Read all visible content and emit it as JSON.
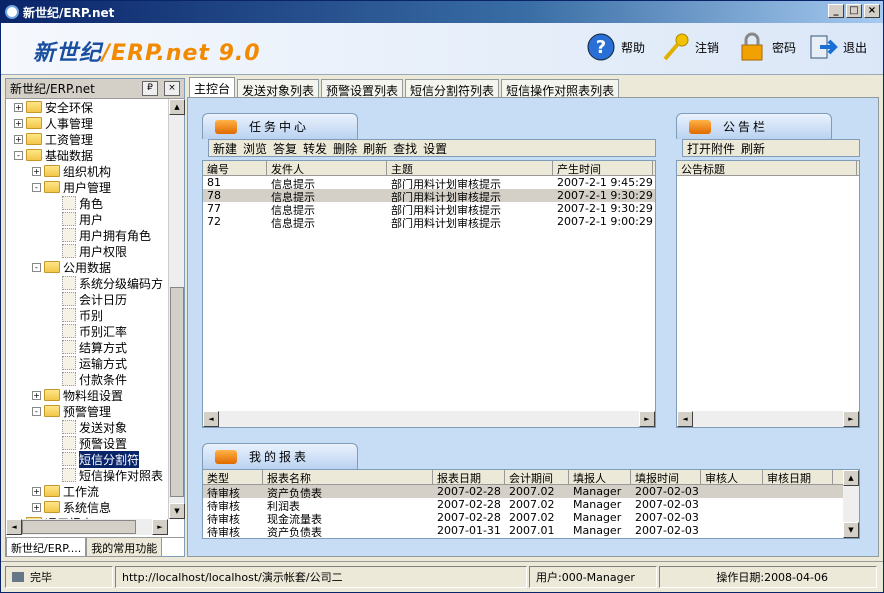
{
  "window": {
    "title": "新世纪/ERP.net",
    "controls": [
      "_",
      "□",
      "×"
    ]
  },
  "header": {
    "logo_main": "新世纪",
    "logo_suffix": "/ERP.net 9.0",
    "help": "帮助",
    "logout": "注销",
    "password": "密码",
    "exit": "退出"
  },
  "left": {
    "title": "新世纪/ERP.net",
    "pin": "₽",
    "close": "×",
    "tabs": [
      "新世纪/ERP....",
      "我的常用功能"
    ],
    "tree": [
      {
        "label": "安全环保",
        "level": 0,
        "type": "folder",
        "exp": "+"
      },
      {
        "label": "人事管理",
        "level": 0,
        "type": "folder",
        "exp": "+"
      },
      {
        "label": "工资管理",
        "level": 0,
        "type": "folder",
        "exp": "+"
      },
      {
        "label": "基础数据",
        "level": 0,
        "type": "folder",
        "exp": "-"
      },
      {
        "label": "组织机构",
        "level": 1,
        "type": "folder",
        "exp": "+"
      },
      {
        "label": "用户管理",
        "level": 1,
        "type": "folder",
        "exp": "-"
      },
      {
        "label": "角色",
        "level": 2,
        "type": "leaf"
      },
      {
        "label": "用户",
        "level": 2,
        "type": "leaf"
      },
      {
        "label": "用户拥有角色",
        "level": 2,
        "type": "leaf"
      },
      {
        "label": "用户权限",
        "level": 2,
        "type": "leaf"
      },
      {
        "label": "公用数据",
        "level": 1,
        "type": "folder",
        "exp": "-"
      },
      {
        "label": "系统分级编码方",
        "level": 2,
        "type": "leaf"
      },
      {
        "label": "会计日历",
        "level": 2,
        "type": "leaf"
      },
      {
        "label": "币别",
        "level": 2,
        "type": "leaf"
      },
      {
        "label": "币别汇率",
        "level": 2,
        "type": "leaf"
      },
      {
        "label": "结算方式",
        "level": 2,
        "type": "leaf"
      },
      {
        "label": "运输方式",
        "level": 2,
        "type": "leaf"
      },
      {
        "label": "付款条件",
        "level": 2,
        "type": "leaf"
      },
      {
        "label": "物料组设置",
        "level": 1,
        "type": "folder",
        "exp": "+"
      },
      {
        "label": "预警管理",
        "level": 1,
        "type": "folder",
        "exp": "-"
      },
      {
        "label": "发送对象",
        "level": 2,
        "type": "leaf"
      },
      {
        "label": "预警设置",
        "level": 2,
        "type": "leaf"
      },
      {
        "label": "短信分割符",
        "level": 2,
        "type": "leaf",
        "selected": true
      },
      {
        "label": "短信操作对照表",
        "level": 2,
        "type": "leaf"
      },
      {
        "label": "工作流",
        "level": 1,
        "type": "folder",
        "exp": "+"
      },
      {
        "label": "系统信息",
        "level": 1,
        "type": "folder",
        "exp": "+"
      },
      {
        "label": "通用报表",
        "level": 0,
        "type": "folder",
        "exp": "+"
      }
    ]
  },
  "tabs": [
    {
      "label": "主控台",
      "active": true
    },
    {
      "label": "发送对象列表"
    },
    {
      "label": "预警设置列表"
    },
    {
      "label": "短信分割符列表"
    },
    {
      "label": "短信操作对照表列表"
    }
  ],
  "task": {
    "title": "任务中心",
    "toolbar": [
      "新建",
      "浏览",
      "答复",
      "转发",
      "删除",
      "刷新",
      "查找",
      "设置"
    ],
    "columns": [
      "编号",
      "发件人",
      "主题",
      "产生时间"
    ],
    "rows": [
      [
        "81",
        "信息提示",
        "部门用料计划审核提示",
        "2007-2-1 9:45:29"
      ],
      [
        "78",
        "信息提示",
        "部门用料计划审核提示",
        "2007-2-1 9:30:29"
      ],
      [
        "77",
        "信息提示",
        "部门用料计划审核提示",
        "2007-2-1 9:30:29"
      ],
      [
        "72",
        "信息提示",
        "部门用料计划审核提示",
        "2007-2-1 9:00:29"
      ]
    ]
  },
  "notice": {
    "title": "公告栏",
    "toolbar": [
      "打开附件",
      "刷新"
    ],
    "columns": [
      "公告标题"
    ]
  },
  "report": {
    "title": "我的报表",
    "columns": [
      "类型",
      "报表名称",
      "报表日期",
      "会计期间",
      "填报人",
      "填报时间",
      "审核人",
      "审核日期"
    ],
    "rows": [
      [
        "待审核",
        "资产负债表",
        "2007-02-28",
        "2007.02",
        "Manager",
        "2007-02-03",
        "",
        ""
      ],
      [
        "待审核",
        "利润表",
        "2007-02-28",
        "2007.02",
        "Manager",
        "2007-02-03",
        "",
        ""
      ],
      [
        "待审核",
        "现金流量表",
        "2007-02-28",
        "2007.02",
        "Manager",
        "2007-02-03",
        "",
        ""
      ],
      [
        "待审核",
        "资产负债表",
        "2007-01-31",
        "2007.01",
        "Manager",
        "2007-02-03",
        "",
        ""
      ]
    ]
  },
  "status": {
    "state": "完毕",
    "url": "http://localhost/localhost/演示帐套/公司二",
    "user": "用户:000-Manager",
    "date": "操作日期:2008-04-06"
  }
}
